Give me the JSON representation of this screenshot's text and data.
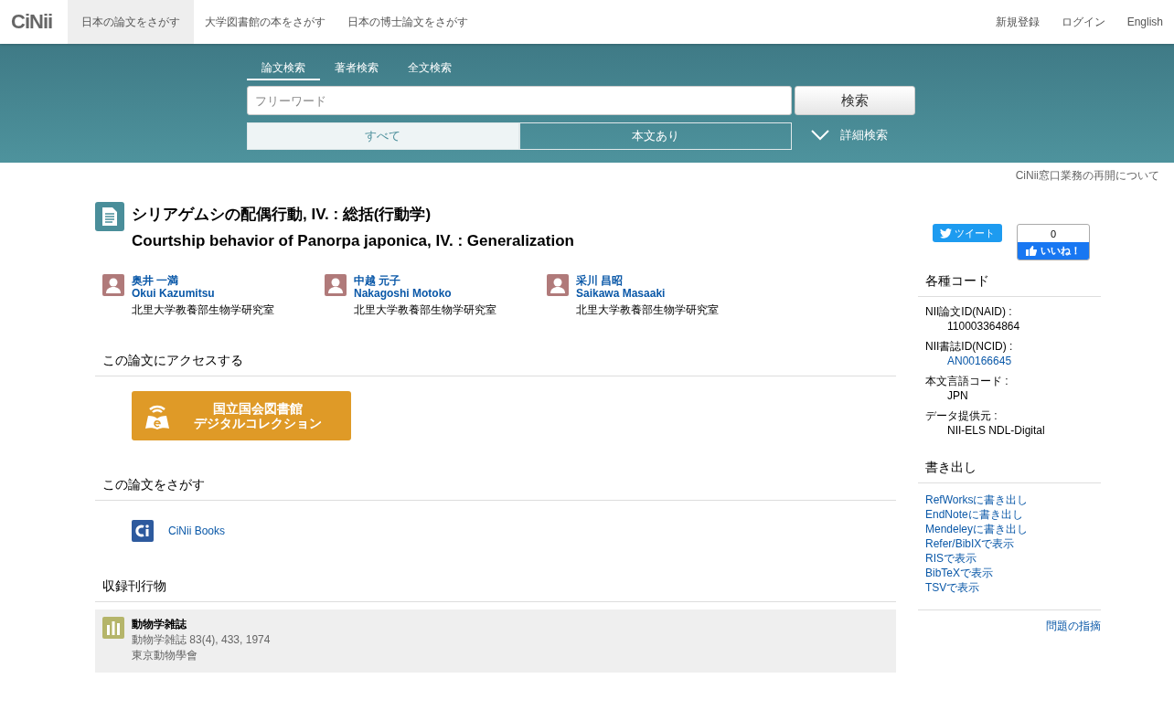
{
  "header": {
    "logo": "CiNii",
    "nav": [
      {
        "label": "日本の論文をさがす",
        "selected": true
      },
      {
        "label": "大学図書館の本をさがす",
        "selected": false
      },
      {
        "label": "日本の博士論文をさがす",
        "selected": false
      }
    ],
    "links": [
      "新規登録",
      "ログイン",
      "English"
    ]
  },
  "search": {
    "tabs": [
      {
        "label": "論文検索",
        "selected": true
      },
      {
        "label": "著者検索",
        "selected": false
      },
      {
        "label": "全文検索",
        "selected": false
      }
    ],
    "placeholder": "フリーワード",
    "button": "検索",
    "filters": [
      {
        "label": "すべて",
        "selected": true
      },
      {
        "label": "本文あり",
        "selected": false
      }
    ],
    "advanced": "詳細検索"
  },
  "notice": "CiNii窓口業務の再開について",
  "article": {
    "title_ja": "シリアゲムシの配偶行動, IV. : 総括(行動学)",
    "title_en": "Courtship behavior of Panorpa japonica, IV. : Generalization",
    "authors": [
      {
        "name_ja": "奥井 一満",
        "name_en": "Okui Kazumitsu",
        "affiliation": "北里大学教養部生物学研究室"
      },
      {
        "name_ja": "中越 元子",
        "name_en": "Nakagoshi Motoko",
        "affiliation": "北里大学教養部生物学研究室"
      },
      {
        "name_ja": "采川 昌昭",
        "name_en": "Saikawa Masaaki",
        "affiliation": "北里大学教養部生物学研究室"
      }
    ]
  },
  "access": {
    "heading": "この論文にアクセスする",
    "banner": [
      "国立国会図書館",
      "デジタルコレクション"
    ]
  },
  "find": {
    "heading": "この論文をさがす",
    "link": "CiNii Books"
  },
  "publication": {
    "heading": "収録刊行物",
    "title": "動物学雑誌",
    "detail": "動物学雑誌 83(4), 433, 1974",
    "publisher": "東京動物學會"
  },
  "social": {
    "tweet": "ツイート",
    "like_count": "0",
    "like": "いいね！"
  },
  "codes": {
    "heading": "各種コード",
    "items": [
      {
        "label": "NII論文ID(NAID) :",
        "value": "110003364864",
        "link": false
      },
      {
        "label": "NII書誌ID(NCID) :",
        "value": "AN00166645",
        "link": true
      },
      {
        "label": "本文言語コード :",
        "value": "JPN",
        "link": false
      },
      {
        "label": "データ提供元 :",
        "value": "NII-ELS  NDL-Digital",
        "link": false
      }
    ]
  },
  "export": {
    "heading": "書き出し",
    "links": [
      "RefWorksに書き出し",
      "EndNoteに書き出し",
      "Mendeleyに書き出し",
      "Refer/BibIXで表示",
      "RISで表示",
      "BibTeXで表示",
      "TSVで表示"
    ]
  },
  "report": "問題の指摘"
}
